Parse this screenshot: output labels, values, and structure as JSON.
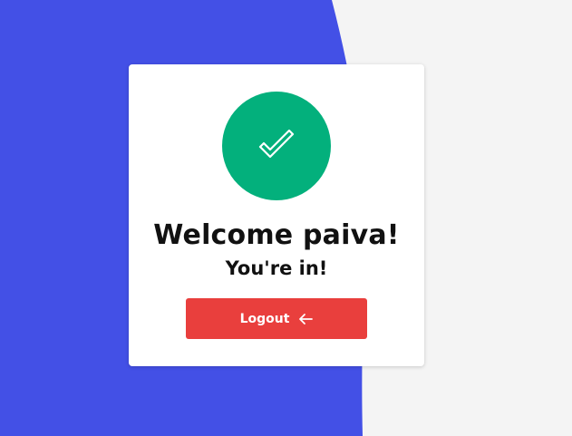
{
  "colors": {
    "background": "#f4f4f4",
    "accent_shape": "#4350e6",
    "card": "#ffffff",
    "success": "#03b07c",
    "logout_button": "#e93f3d"
  },
  "card": {
    "icon": "check-icon",
    "title": "Welcome paiva!",
    "subtitle": "You're in!",
    "logout_label": "Logout",
    "logout_icon": "arrow-left-icon"
  }
}
